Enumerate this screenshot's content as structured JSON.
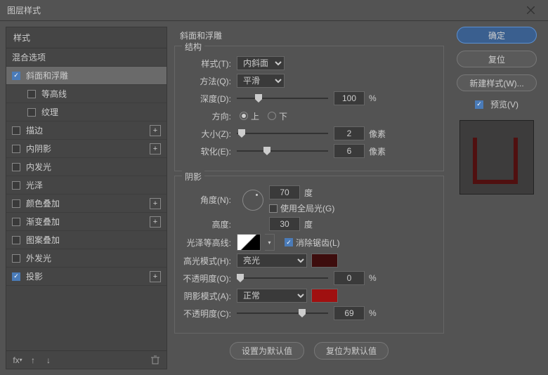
{
  "title": "图层样式",
  "left": {
    "head": "样式",
    "blend": "混合选项",
    "items": [
      {
        "label": "斜面和浮雕",
        "checked": true,
        "selected": true,
        "plus": false
      },
      {
        "label": "等高线",
        "checked": false,
        "indent": true,
        "plus": false
      },
      {
        "label": "纹理",
        "checked": false,
        "indent": true,
        "plus": false
      },
      {
        "label": "描边",
        "checked": false,
        "plus": true
      },
      {
        "label": "内阴影",
        "checked": false,
        "plus": true
      },
      {
        "label": "内发光",
        "checked": false,
        "plus": false
      },
      {
        "label": "光泽",
        "checked": false,
        "plus": false
      },
      {
        "label": "颜色叠加",
        "checked": false,
        "plus": true
      },
      {
        "label": "渐变叠加",
        "checked": false,
        "plus": true
      },
      {
        "label": "图案叠加",
        "checked": false,
        "plus": false
      },
      {
        "label": "外发光",
        "checked": false,
        "plus": false
      },
      {
        "label": "投影",
        "checked": true,
        "plus": true
      }
    ]
  },
  "center": {
    "title": "斜面和浮雕",
    "struct": {
      "legend": "结构",
      "style_l": "样式(T):",
      "style_v": "内斜面",
      "tech_l": "方法(Q):",
      "tech_v": "平滑",
      "depth_l": "深度(D):",
      "depth_v": "100",
      "pct": "%",
      "dir_l": "方向:",
      "up": "上",
      "down": "下",
      "size_l": "大小(Z):",
      "size_v": "2",
      "px": "像素",
      "soft_l": "软化(E):",
      "soft_v": "6"
    },
    "shade": {
      "legend": "阴影",
      "angle_l": "角度(N):",
      "angle_v": "70",
      "deg": "度",
      "global_l": "使用全局光(G)",
      "alt_l": "高度:",
      "alt_v": "30",
      "gloss_l": "光泽等高线:",
      "anti_l": "消除锯齿(L)",
      "hmode_l": "高光模式(H):",
      "hmode_v": "亮光",
      "hcolor": "#3d0d0d",
      "hopa_l": "不透明度(O):",
      "hopa_v": "0",
      "smode_l": "阴影模式(A):",
      "smode_v": "正常",
      "scolor": "#a01010",
      "sopa_l": "不透明度(C):",
      "sopa_v": "69"
    },
    "btn1": "设置为默认值",
    "btn2": "复位为默认值"
  },
  "right": {
    "ok": "确定",
    "cancel": "复位",
    "new": "新建样式(W)...",
    "preview": "预览(V)"
  }
}
